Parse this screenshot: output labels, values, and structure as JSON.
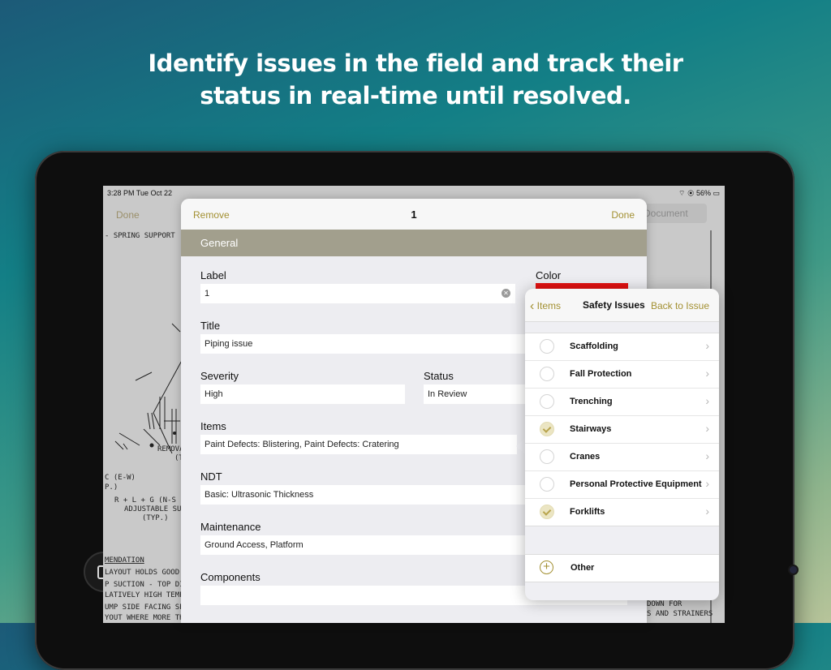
{
  "hero": {
    "line1": "Identify issues in the field and track their",
    "line2": "status in real-time until resolved."
  },
  "device": {
    "status_time": "3:28 PM   Tue Oct 22",
    "status_right": "⌔ ◉ 56% ▭"
  },
  "background_app": {
    "done_label": "Done",
    "document_label": "Document",
    "drawing_texts": [
      "- SPRING SUPPORT",
      "REMOVA",
      "(T",
      "C (E-W)",
      "P.)",
      "R + L + G (N-S",
      "ADJUSTABLE SUPP",
      "(TYP.)",
      "MENDATION",
      "LAYOUT HOLDS GOOD F",
      "P SUCTION - TOP DISC",
      "LATIVELY HIGH TEMPE",
      "UMP SIDE FACING SPUR",
      "YOUT WHERE MORE TH",
      "DOWN FOR",
      "S AND STRAINERS"
    ]
  },
  "issue_sheet": {
    "remove_label": "Remove",
    "title": "1",
    "done_label": "Done",
    "section_label": "General",
    "label_label": "Label",
    "label_value": "1",
    "color_label": "Color",
    "color_value": "#e21111",
    "title_label": "Title",
    "title_value": "Piping issue",
    "severity_label": "Severity",
    "severity_value": "High",
    "status_label": "Status",
    "status_value": "In Review",
    "items_label": "Items",
    "items_value": "Paint Defects: Blistering, Paint Defects: Cratering",
    "ndt_label": "NDT",
    "ndt_value": "Basic: Ultrasonic Thickness",
    "maintenance_label": "Maintenance",
    "maintenance_value": "Ground Access, Platform",
    "components_label": "Components",
    "components_value": ""
  },
  "popover": {
    "back_label": "Items",
    "title": "Safety Issues",
    "right_label": "Back to Issue",
    "items": [
      {
        "label": "Scaffolding",
        "checked": false
      },
      {
        "label": "Fall Protection",
        "checked": false
      },
      {
        "label": "Trenching",
        "checked": false
      },
      {
        "label": "Stairways",
        "checked": true
      },
      {
        "label": "Cranes",
        "checked": false
      },
      {
        "label": "Personal Protective Equipment",
        "checked": false
      },
      {
        "label": "Forklifts",
        "checked": true
      }
    ],
    "other_label": "Other"
  },
  "colors": {
    "accent": "#a39032",
    "section_header": "#a29f8d",
    "swatch_red": "#e21111"
  }
}
